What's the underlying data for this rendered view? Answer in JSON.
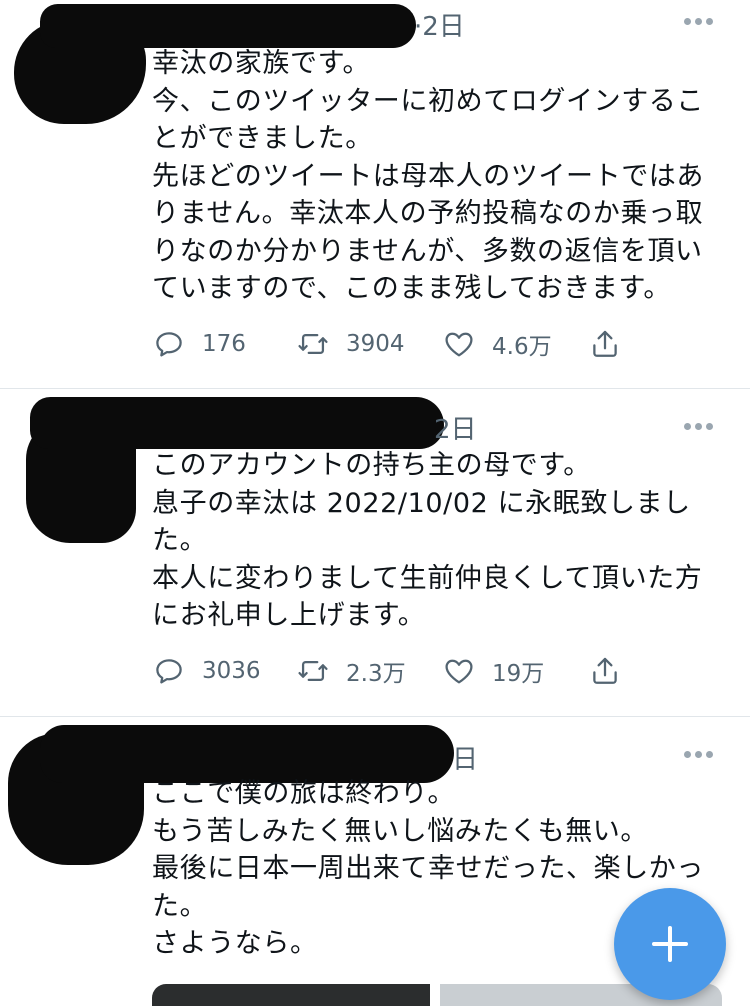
{
  "tweets": [
    {
      "time": "·2日",
      "text": "幸汰の家族です。\n今、このツイッターに初めてログインするこ\nとができました。\n先ほどのツイートは母本人のツイートではあ\nりません。幸汰本人の予約投稿なのか乗っ取\nりなのか分かりませんが、多数の返信を頂い\nていますので、このまま残しておきます。",
      "replies": "176",
      "retweets": "3904",
      "likes": "4.6万"
    },
    {
      "time": "2日",
      "text": "このアカウントの持ち主の母です。\n息子の幸汰は 2022/10/02 に永眠致しまし\nた。\n本人に変わりまして生前仲良くして頂いた方\nにお礼申し上げます。",
      "replies": "3036",
      "retweets": "2.3万",
      "likes": "19万"
    },
    {
      "time": "日",
      "text": "ここで僕の旅は終わり。\nもう苦しみたく無いし悩みたくも無い。\n最後に日本一周出来て幸せだった、楽しかっ\nた。\nさようなら。"
    }
  ],
  "fab": {
    "icon": "plus-icon"
  },
  "colors": {
    "accent": "#4a99e9",
    "secondary_text": "#536471",
    "divider": "#e1e6ea"
  }
}
